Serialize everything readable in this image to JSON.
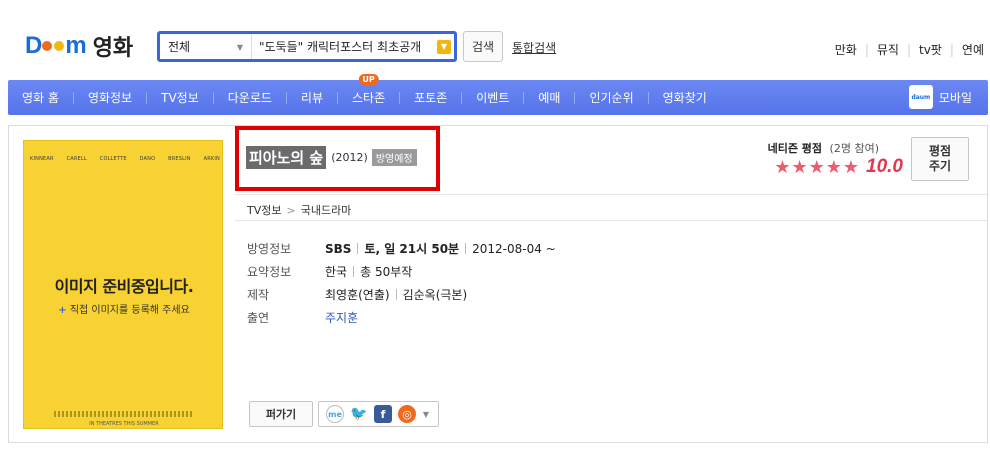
{
  "header": {
    "logo_text": "영화",
    "search_scope": "전체",
    "search_value": "\"도둑들\" 캐릭터포스터 최초공개",
    "search_button": "검색",
    "total_search": "통합검색",
    "links": [
      "만화",
      "뮤직",
      "tv팟",
      "연예"
    ]
  },
  "nav": {
    "items": [
      {
        "label": "영화 홈"
      },
      {
        "label": "영화정보"
      },
      {
        "label": "TV정보"
      },
      {
        "label": "다운로드"
      },
      {
        "label": "리뷰"
      },
      {
        "label": "스타존",
        "badge": "UP"
      },
      {
        "label": "포토존"
      },
      {
        "label": "이벤트"
      },
      {
        "label": "예매"
      },
      {
        "label": "인기순위"
      },
      {
        "label": "영화찾기"
      }
    ],
    "mobile_label": "모바일",
    "mobile_icon_text": "daum"
  },
  "poster": {
    "names": [
      "KINNEAR",
      "CARELL",
      "COLLETTE",
      "DANO",
      "BRESLIN",
      "ARKIN"
    ],
    "title": "이미지 준비중입니다.",
    "subtitle": "직접 이미지를 등록해 주세요",
    "foot": "IN THEATRES THIS SUMMER"
  },
  "movie": {
    "title": "피아노의 숲",
    "year": "(2012)",
    "status": "방영예정"
  },
  "rating": {
    "label": "네티즌 평점",
    "count": "(2명 참여)",
    "stars": 5,
    "score": "10.0",
    "button_line1": "평점",
    "button_line2": "주기"
  },
  "breadcrumb": [
    "TV정보",
    "국내드라마"
  ],
  "info": {
    "broadcast_label": "방영정보",
    "broadcast_channel": "SBS",
    "broadcast_time": "토, 일 21시 50분",
    "broadcast_date": "2012-08-04 ~",
    "summary_label": "요약정보",
    "summary_country": "한국",
    "summary_episodes": "총 50부작",
    "production_label": "제작",
    "production_director": "최영훈(연출)",
    "production_writer": "김순옥(극본)",
    "cast_label": "출연",
    "cast": "주지훈"
  },
  "share": {
    "pergagi_label": "퍼가기"
  },
  "colors": {
    "nav_bg": "#5f7ff0",
    "search_border": "#3a67d8",
    "star": "#f05a6e",
    "highlight": "#e00000",
    "poster_bg": "#f7d232"
  }
}
